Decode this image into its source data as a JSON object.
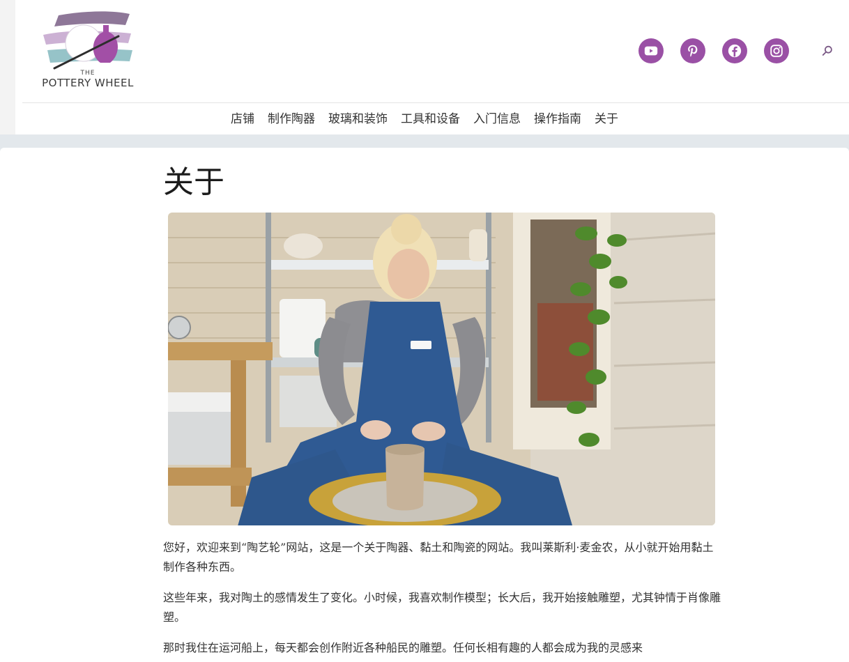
{
  "brand": {
    "logo_the": "THE",
    "logo_name": "POTTERY WHEEL"
  },
  "social": [
    {
      "name": "youtube-icon"
    },
    {
      "name": "pinterest-icon"
    },
    {
      "name": "facebook-icon"
    },
    {
      "name": "instagram-icon"
    }
  ],
  "colors": {
    "accent": "#9a50a5",
    "header_bg": "#ffffff",
    "page_bg": "#e3e8ec"
  },
  "nav": {
    "items": [
      "店铺",
      "制作陶器",
      "玻璃和装饰",
      "工具和设备",
      "入门信息",
      "操作指南",
      "关于"
    ]
  },
  "page": {
    "title": "关于",
    "paragraphs": [
      "您好，欢迎来到“陶艺轮”网站，这是一个关于陶器、黏土和陶瓷的网站。我叫莱斯利·麦金农，从小就开始用黏土制作各种东西。",
      "这些年来，我对陶土的感情发生了变化。小时候，我喜欢制作模型；长大后，我开始接触雕塑，尤其钟情于肖像雕塑。",
      "那时我住在运河船上，每天都会创作附近各种船民的雕塑。任何长相有趣的人都会成为我的灵感来"
    ]
  }
}
